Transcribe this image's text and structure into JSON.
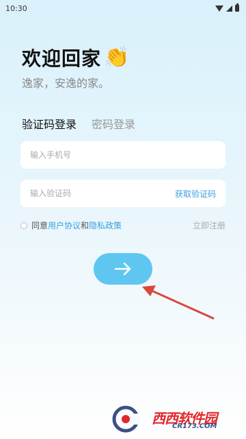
{
  "status_bar": {
    "time": "10:30"
  },
  "header": {
    "title": "欢迎回家",
    "title_emoji": "👏",
    "subtitle": "逸家，安逸的家。"
  },
  "tabs": [
    {
      "label": "验证码登录",
      "active": true
    },
    {
      "label": "密码登录",
      "active": false
    }
  ],
  "form": {
    "phone_placeholder": "输入手机号",
    "phone_value": "",
    "code_placeholder": "输入验证码",
    "code_value": "",
    "get_code_label": "获取验证码"
  },
  "agreement": {
    "prefix": "同意",
    "user_agreement": "用户协议",
    "and": "和",
    "privacy_policy": "隐私政策",
    "checked": false,
    "register_label": "立即注册"
  },
  "submit": {
    "icon": "arrow-right-icon"
  },
  "colors": {
    "accent": "#5fc6f1",
    "link": "#3a9fe0",
    "annotation": "#d9483b"
  },
  "watermark": {
    "brand": "西西软件园",
    "url": "CR173.COM"
  }
}
